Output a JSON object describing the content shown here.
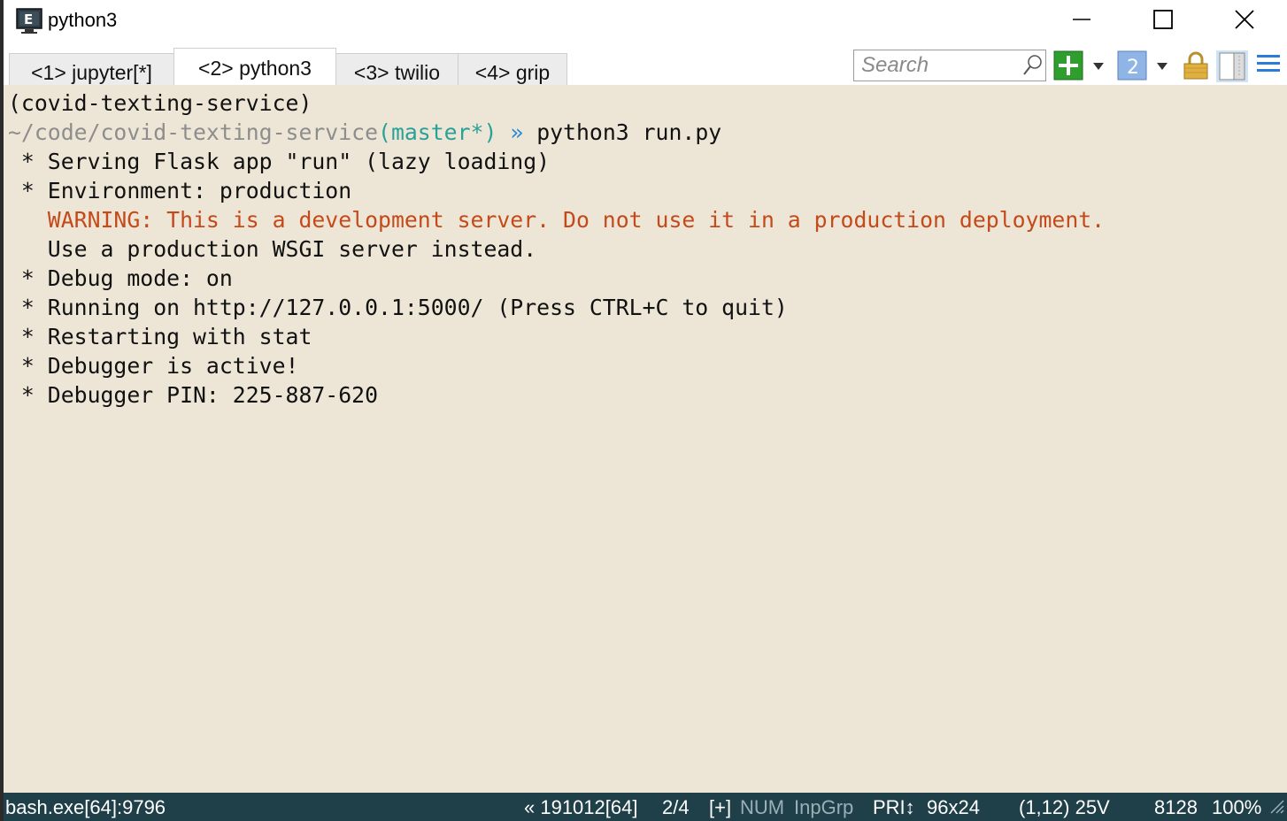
{
  "window": {
    "title": "python3",
    "controls": {
      "minimize_icon": "minimize-icon",
      "maximize_icon": "maximize-icon",
      "close_icon": "close-icon"
    }
  },
  "tabs": [
    {
      "label": "<1> jupyter[*]",
      "active": false
    },
    {
      "label": "<2> python3",
      "active": true
    },
    {
      "label": "<3> twilio",
      "active": false
    },
    {
      "label": "<4> grip",
      "active": false
    }
  ],
  "toolbar": {
    "search_placeholder": "Search",
    "new_console_icon": "plus-icon",
    "new_console_color": "#2f9e2f",
    "console_number": "2",
    "lock_icon": "lock-icon",
    "split_icon": "split-view-icon",
    "menu_icon": "hamburger-menu-icon"
  },
  "terminal": {
    "background": "#ede6d6",
    "venv": "(covid-texting-service)",
    "prompt_path": "~/code/covid-texting-service",
    "prompt_branch": "(master*)",
    "prompt_arrow": " » ",
    "command": "python3 run.py",
    "output": {
      "l1": " * Serving Flask app \"run\" (lazy loading)",
      "l2": " * Environment: production",
      "warning": "   WARNING: This is a development server. Do not use it in a production deployment.",
      "l4": "   Use a production WSGI server instead.",
      "l5": " * Debug mode: on",
      "l6": " * Running on http://127.0.0.1:5000/ (Press CTRL+C to quit)",
      "l7": " * Restarting with stat",
      "l8": " * Debugger is active!",
      "l9": " * Debugger PIN: 225-887-620"
    },
    "warning_color": "#c44a1a"
  },
  "statusbar": {
    "process": "bash.exe[64]:9796",
    "build": "« 191012[64]",
    "console_index": "2/4",
    "plus": "[+]",
    "num": "NUM",
    "inpgrp": "InpGrp",
    "pri": "PRI↕",
    "size": "96x24",
    "cursor": "(1,12) 25V",
    "pid": "8128",
    "zoom": "100%",
    "background": "#1f3f49"
  }
}
